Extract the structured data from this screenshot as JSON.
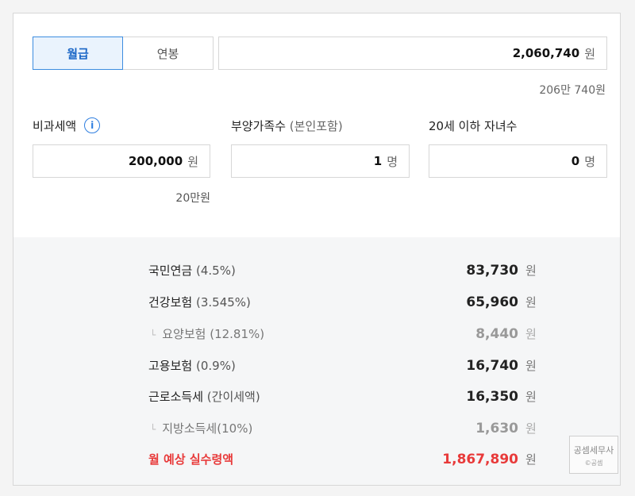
{
  "tabs": {
    "monthly": "월급",
    "annual": "연봉"
  },
  "salary": {
    "value": "2,060,740",
    "unit": "원",
    "korean": "206만 740원"
  },
  "nontax": {
    "label": "비과세액",
    "info_icon": "info-icon",
    "value": "200,000",
    "unit": "원",
    "korean": "20만원"
  },
  "dependents": {
    "label": "부양가족수",
    "paren": "(본인포함)",
    "value": "1",
    "unit": "명"
  },
  "children": {
    "label": "20세 이하 자녀수",
    "value": "0",
    "unit": "명"
  },
  "deductions": [
    {
      "label": "국민연금",
      "pct": "(4.5%)",
      "amount": "83,730",
      "unit": "원"
    },
    {
      "label": "건강보험",
      "pct": "(3.545%)",
      "amount": "65,960",
      "unit": "원"
    },
    {
      "arrow": "└",
      "label": "요양보험",
      "pct": "(12.81%)",
      "amount": "8,440",
      "unit": "원"
    },
    {
      "label": "고용보험",
      "pct": "(0.9%)",
      "amount": "16,740",
      "unit": "원"
    },
    {
      "label": "근로소득세",
      "pct": "(간이세액)",
      "amount": "16,350",
      "unit": "원"
    },
    {
      "arrow": "└",
      "label": "지방소득세",
      "pct": "(10%)",
      "amount": "1,630",
      "unit": "원"
    }
  ],
  "total": {
    "label": "월 예상 실수령액",
    "amount": "1,867,890",
    "unit": "원"
  },
  "stamp": {
    "line1": "공셈세무사",
    "line2": "©공셈"
  }
}
